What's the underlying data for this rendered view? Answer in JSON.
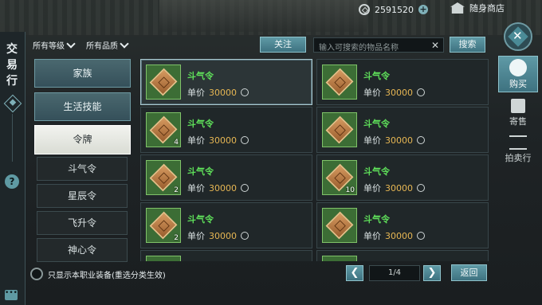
{
  "window": {
    "title": "交易行"
  },
  "currency": {
    "amount": "2591520",
    "shop_label": "随身商店"
  },
  "filters": {
    "level": "所有等级",
    "quality": "所有品质",
    "follow_label": "关注",
    "search_placeholder": "输入可搜索的物品名称",
    "search_label": "搜索"
  },
  "categories": {
    "main": [
      "家族",
      "生活技能"
    ],
    "selected": "令牌",
    "sub": [
      "斗气令",
      "星辰令",
      "飞升令",
      "神心令"
    ]
  },
  "items": [
    {
      "name": "斗气令",
      "price_label": "单价",
      "price": "30000",
      "qty": ""
    },
    {
      "name": "斗气令",
      "price_label": "单价",
      "price": "30000",
      "qty": ""
    },
    {
      "name": "斗气令",
      "price_label": "单价",
      "price": "30000",
      "qty": "4"
    },
    {
      "name": "斗气令",
      "price_label": "单价",
      "price": "30000",
      "qty": ""
    },
    {
      "name": "斗气令",
      "price_label": "单价",
      "price": "30000",
      "qty": "2"
    },
    {
      "name": "斗气令",
      "price_label": "单价",
      "price": "30000",
      "qty": "10"
    },
    {
      "name": "斗气令",
      "price_label": "单价",
      "price": "30000",
      "qty": "2"
    },
    {
      "name": "斗气令",
      "price_label": "单价",
      "price": "30000",
      "qty": ""
    }
  ],
  "tabs": [
    "购买",
    "寄售",
    "拍卖行"
  ],
  "bottom": {
    "only_class_label": "只显示本职业装备(重选分类生效)",
    "page": "1/4",
    "back_label": "返回"
  },
  "colors": {
    "accent": "#5f9aa6",
    "item_name": "#5fe05a",
    "price": "#e6b653"
  }
}
